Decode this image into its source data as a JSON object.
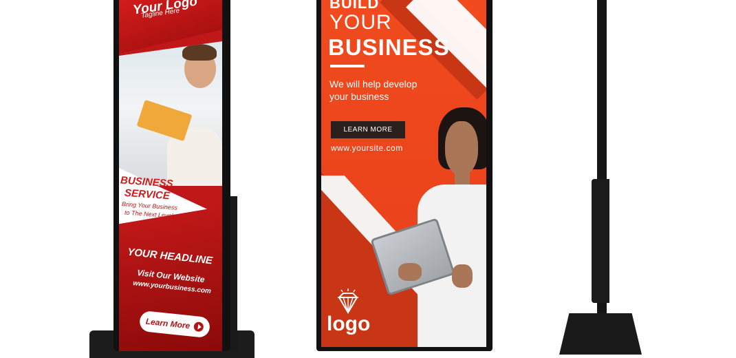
{
  "left_kiosk": {
    "logo_text": "Your Logo",
    "tagline": "Tagline Here",
    "service_line1": "BUSINESS",
    "service_line2": "SERVICE",
    "subtitle_line1": "Bring Your Business",
    "subtitle_line2": "to The Next Level",
    "headline": "YOUR HEADLINE",
    "visit_text": "Visit Our Website",
    "website": "www.yourbusiness.com",
    "button_label": "Learn More"
  },
  "middle_kiosk": {
    "heading_line1": "BUILD",
    "heading_line2": "YOUR",
    "heading_line3": "BUSINESS",
    "description_line1": "We will help develop",
    "description_line2": "your business",
    "button_label": "LEARN MORE",
    "website": "www.yoursite.com",
    "logo_text": "logo"
  },
  "colors": {
    "left_red": "#c01818",
    "middle_orange": "#f04a1e",
    "frame_black": "#111111"
  },
  "icons": [
    "play-icon",
    "diamond-icon"
  ]
}
